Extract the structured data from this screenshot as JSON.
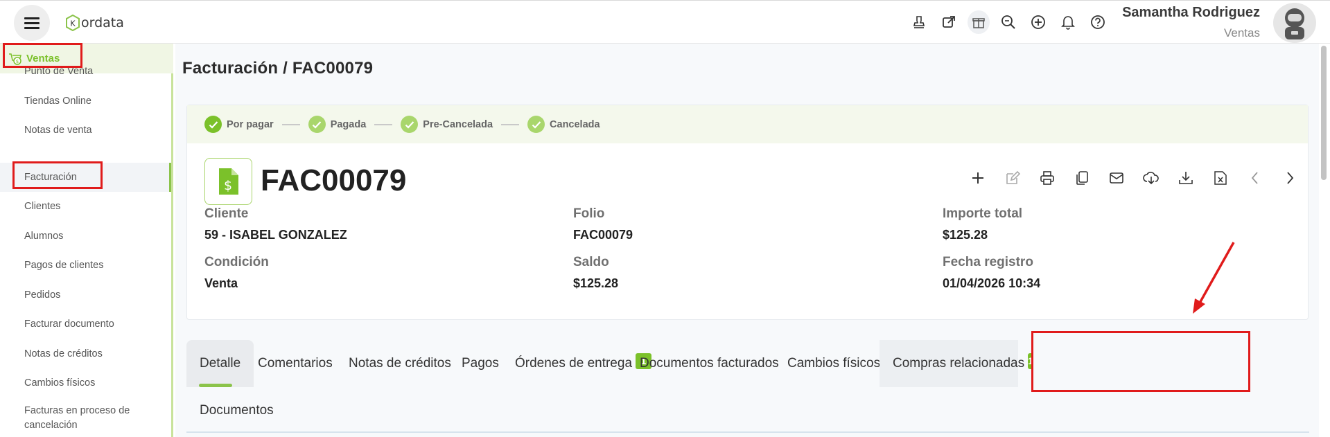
{
  "app": {
    "logo_text": "ordata",
    "logo_letter": "K"
  },
  "user": {
    "name": "Samantha Rodriguez",
    "role": "Ventas"
  },
  "top_icons": [
    "stamp-icon",
    "external-link-icon",
    "gift-icon",
    "search-zoom-icon",
    "add-circle-icon",
    "bell-icon",
    "help-icon"
  ],
  "sidebar": {
    "section": "Ventas",
    "items": [
      {
        "label": "Punto de Venta"
      },
      {
        "label": "Tiendas Online"
      },
      {
        "label": "Notas de venta"
      },
      {
        "label": "Facturación",
        "active": true
      },
      {
        "label": "Clientes"
      },
      {
        "label": "Alumnos"
      },
      {
        "label": "Pagos de clientes"
      },
      {
        "label": "Pedidos"
      },
      {
        "label": "Facturar documento"
      },
      {
        "label": "Notas de créditos"
      },
      {
        "label": "Cambios físicos"
      },
      {
        "label": "Facturas en proceso de cancelación"
      }
    ]
  },
  "page": {
    "breadcrumb": "Facturación /  FAC00079"
  },
  "status_steps": [
    "Por pagar",
    "Pagada",
    "Pre-Cancelada",
    "Cancelada"
  ],
  "document": {
    "id": "FAC00079",
    "fields": {
      "cliente_label": "Cliente",
      "cliente_value": "59 - ISABEL GONZALEZ",
      "folio_label": "Folio",
      "folio_value": "FAC00079",
      "importe_label": "Importe total",
      "importe_value": "$125.28",
      "condicion_label": "Condición",
      "condicion_value": "Venta",
      "saldo_label": "Saldo",
      "saldo_value": "$125.28",
      "fecha_label": "Fecha registro",
      "fecha_value": "01/04/2026 10:34"
    }
  },
  "actions": [
    "add-icon",
    "edit-icon",
    "print-icon",
    "copy-icon",
    "email-icon",
    "cloud-download-icon",
    "download-icon",
    "excel-icon",
    "previous-icon",
    "next-icon"
  ],
  "tabs": [
    {
      "label": "Detalle"
    },
    {
      "label": "Comentarios"
    },
    {
      "label": "Notas de créditos"
    },
    {
      "label": "Pagos"
    },
    {
      "label": "Órdenes de entrega",
      "badge": "1"
    },
    {
      "label": "Documentos facturados"
    },
    {
      "label": "Cambios físicos"
    },
    {
      "label": "Compras relacionadas",
      "badge": "1"
    },
    {
      "label": "Documentos"
    }
  ],
  "colors": {
    "accent": "#7bc12a",
    "annotation": "#e01b1b"
  }
}
